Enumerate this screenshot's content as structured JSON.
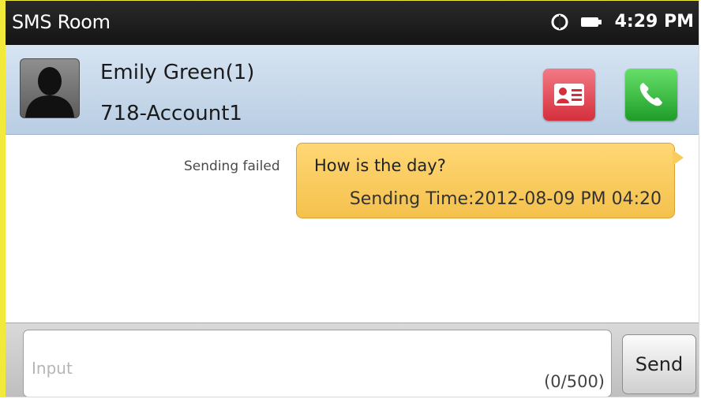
{
  "titlebar": {
    "title": "SMS Room",
    "time": "4:29 PM",
    "icons": [
      "shield-icon",
      "battery-icon"
    ]
  },
  "contact": {
    "name": "Emily Green(1)",
    "account": "718-Account1",
    "avatar_icon": "person-silhouette-icon",
    "buttons": [
      "contact-card-icon",
      "phone-icon"
    ],
    "colors": {
      "card": "#d52f3c",
      "call": "#1f9d29"
    }
  },
  "messages": [
    {
      "text": "How is the day?",
      "sending_time": "Sending Time:2012-08-09 PM 04:20",
      "status": "Sending failed",
      "bubble_color": "#f4c14d"
    }
  ],
  "composer": {
    "placeholder": "Input",
    "counter": "(0/500)",
    "send_label": "Send"
  }
}
